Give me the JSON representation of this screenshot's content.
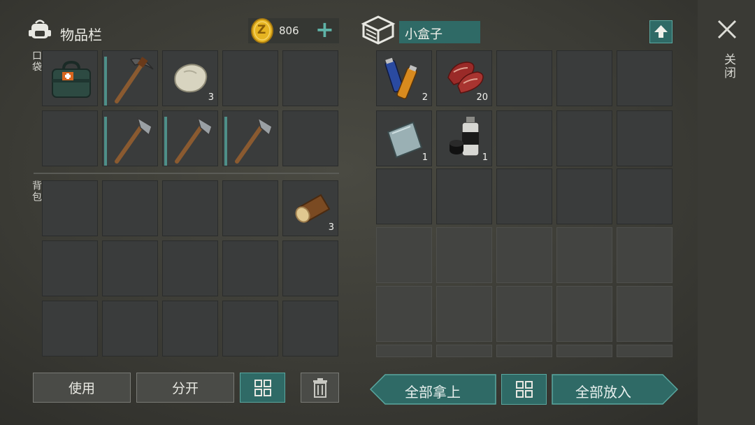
{
  "inventory": {
    "title": "物品栏",
    "coins": "806",
    "coin_symbol": "Z",
    "add_label": "+",
    "pocket_label": "口袋",
    "backpack_label": "背包",
    "slots": {
      "medkit": "",
      "pickaxe": "",
      "stone": "3",
      "hatchet1": "",
      "hatchet2": "",
      "hatchet3": "",
      "log": "3"
    },
    "use_label": "使用",
    "split_label": "分开"
  },
  "container": {
    "title": "小盒子",
    "slots": {
      "batteries": "2",
      "meat": "20",
      "plate": "1",
      "spray": "1"
    },
    "take_all_label": "全部拿上",
    "put_all_label": "全部放入"
  },
  "close_label": "关闭",
  "colors": {
    "teal_accent": "#2f6a66",
    "durability": "#4e8f88",
    "coin": "#e6b422"
  }
}
